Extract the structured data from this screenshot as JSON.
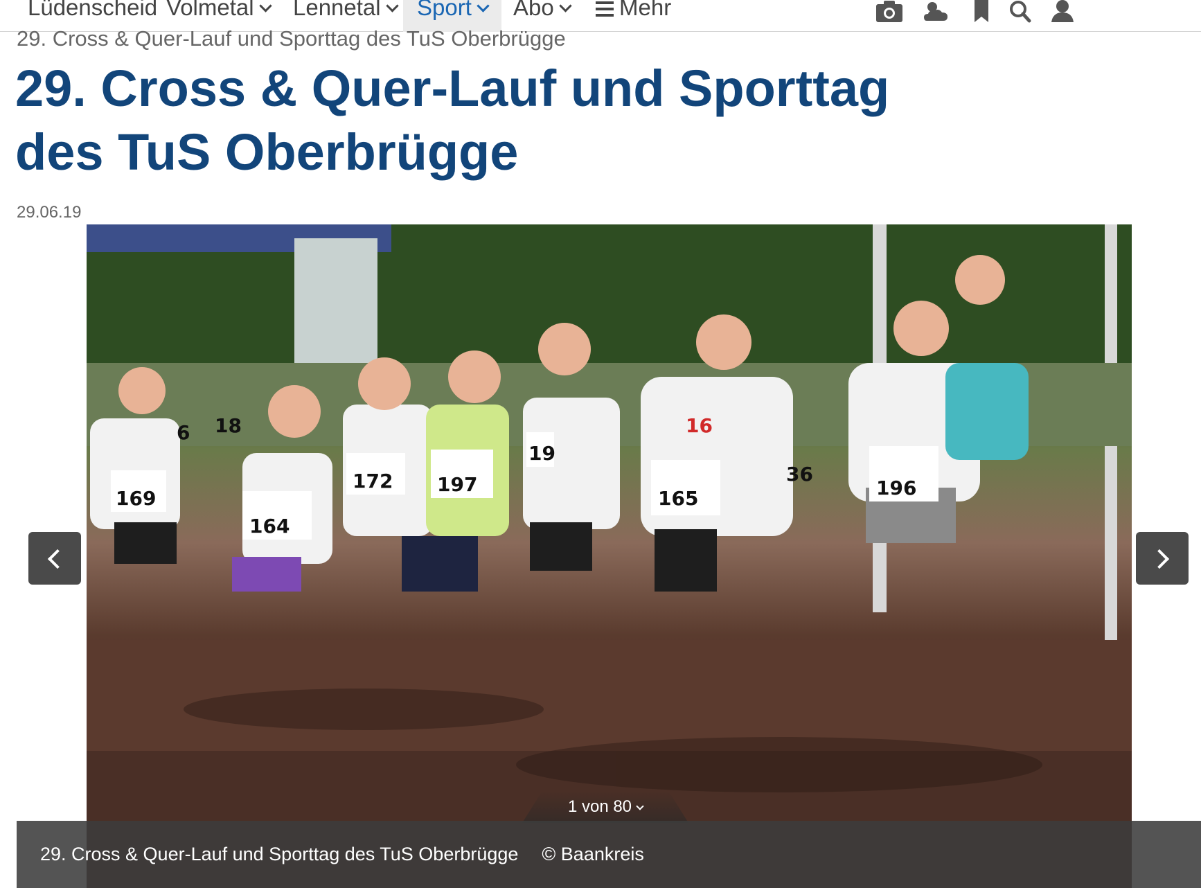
{
  "nav": {
    "items": [
      {
        "label": "Lüdenscheid",
        "dropdown": false,
        "active": false
      },
      {
        "label": "Volmetal",
        "dropdown": true,
        "active": false
      },
      {
        "label": "Lennetal",
        "dropdown": true,
        "active": false
      },
      {
        "label": "Sport",
        "dropdown": true,
        "active": true
      },
      {
        "label": "Abo",
        "dropdown": true,
        "active": false
      },
      {
        "label": "Mehr",
        "dropdown": false,
        "active": false
      }
    ],
    "icons": [
      "camera-icon",
      "weather-icon",
      "bookmark-icon",
      "search-icon",
      "user-icon"
    ],
    "active_color": "#1a66b3"
  },
  "article": {
    "kicker": "29. Cross & Quer-Lauf und Sporttag des TuS Oberbrügge",
    "headline": "29. Cross & Quer-Lauf und Sporttag des TuS Oberbrügge",
    "date": "29.06.19",
    "headline_color": "#12457a"
  },
  "gallery": {
    "counter": "1 von 80",
    "caption_title": "29. Cross & Quer-Lauf und Sporttag des TuS Oberbrügge",
    "caption_credit": "© Baankreis",
    "bibs": [
      "169",
      "164",
      "172",
      "197",
      "19",
      "165",
      "196",
      "16",
      "18",
      "36",
      "6"
    ]
  }
}
